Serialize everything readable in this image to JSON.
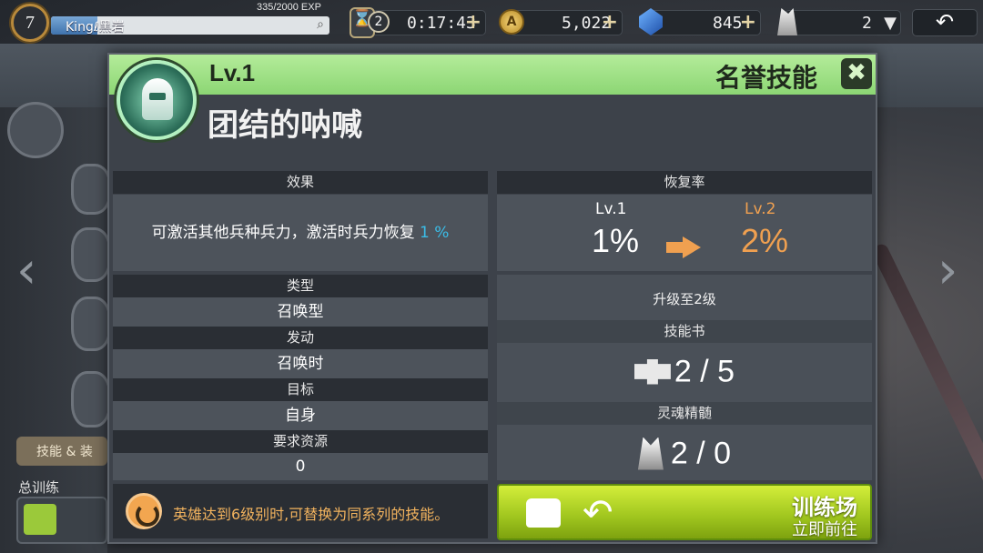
{
  "hud": {
    "level": "7",
    "player_name": "Kingℓ黑岩",
    "exp_text": "335/2000 EXP",
    "exp_fraction": 0.1675,
    "queue_count": "2",
    "timer": "0:17:43",
    "gold": "5,022",
    "gems": "845",
    "crystals": "2",
    "plus": "+",
    "dropdown": "▼",
    "back": "↶",
    "search_icon": "⌕"
  },
  "modal": {
    "level": "Lv.1",
    "category": "名誉技能",
    "close": "✖",
    "skill_name": "团结的呐喊",
    "effect": {
      "title": "效果",
      "text": "可激活其他兵种兵力，激活时兵力恢复",
      "highlight": "1 %"
    },
    "type": {
      "title": "类型",
      "value": "召唤型"
    },
    "trigger": {
      "title": "发动",
      "value": "召唤时"
    },
    "target": {
      "title": "目标",
      "value": "自身"
    },
    "resource": {
      "title": "要求资源",
      "value": "0"
    },
    "recovery": {
      "title": "恢复率",
      "current_lv": "Lv.1",
      "current_val": "1%",
      "next_lv": "Lv.2",
      "next_val": "2%"
    },
    "upgrade": {
      "title": "升级至2级",
      "book_title": "技能书",
      "book_count": "2 / 5",
      "essence_title": "灵魂精髄",
      "essence_count": "2 / 0"
    },
    "note": "英雄达到6级别时,可替换为同系列的技能。",
    "train_button": {
      "title": "训练场",
      "subtitle": "立即前往"
    }
  },
  "background": {
    "tab_label": "技能 & 装",
    "training_label": "总训练"
  },
  "colors": {
    "header_green": "#a6e58a",
    "highlight_blue": "#3bbde8",
    "next_level_orange": "#f0a050",
    "note_orange": "#f2b35e",
    "train_button_green": "#b8dc2c"
  },
  "icons": {
    "skill": "helmet-skill-icon",
    "close": "close-icon",
    "arrow": "arrow-right-icon",
    "book": "puzzle-piece-icon",
    "essence": "crystal-icon",
    "note": "refresh-icon",
    "train": "fist-icon",
    "train_back": "return-arrow-icon"
  }
}
